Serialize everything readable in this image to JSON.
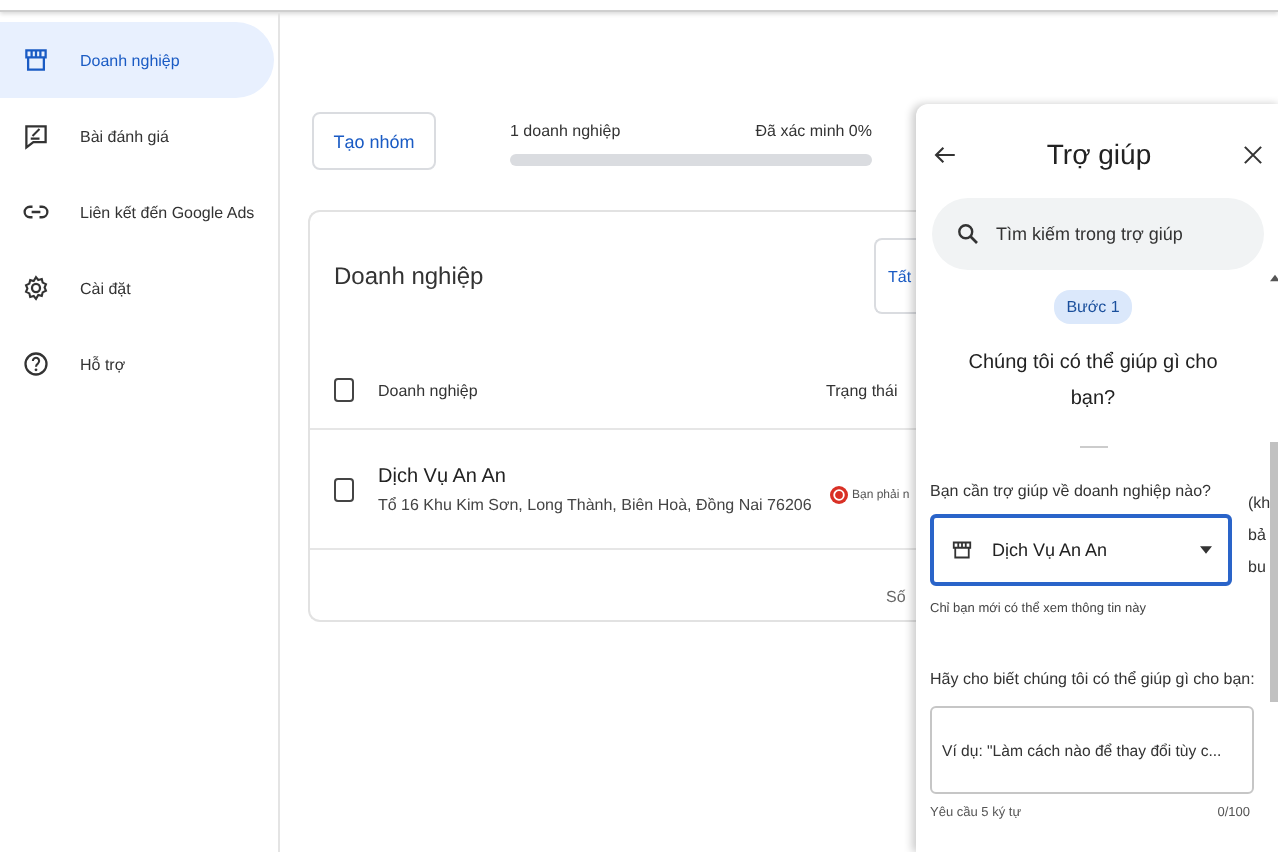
{
  "sidebar": {
    "items": [
      {
        "label": "Doanh nghiệp",
        "kind": "store",
        "selected": true
      },
      {
        "label": "Bài đánh giá",
        "kind": "review",
        "selected": false
      },
      {
        "label": "Liên kết đến Google Ads",
        "kind": "link",
        "selected": false
      },
      {
        "label": "Cài đặt",
        "kind": "settings",
        "selected": false
      },
      {
        "label": "Hỗ trợ",
        "kind": "help",
        "selected": false
      }
    ]
  },
  "toolbar": {
    "create_group_button": "Tạo nhóm",
    "business_count": "1 doanh nghiệp",
    "verified": "Đã xác minh 0%",
    "verified_progress": {
      "level": 0
    }
  },
  "card": {
    "title": "Doanh nghiệp",
    "filter_button": "Tất",
    "header_checked": false,
    "columns": [
      "Doanh nghiệp",
      "Trạng thái"
    ],
    "rows": [
      {
        "name": "Dịch Vụ An An",
        "address": "Tổ 16 Khu Kim Sơn, Long Thành, Biên Hoà, Đồng Nai 76206",
        "checked": false,
        "status": "Bạn phải n"
      }
    ],
    "footer": "Số"
  },
  "help_panel": {
    "title": "Trợ giúp",
    "search": {
      "placeholder": "Tìm kiếm trong trợ giúp"
    },
    "step": "Bước 1",
    "heading": "Chúng tôi có thể giúp gì cho bạn?",
    "business_label": "Bạn cần trợ giúp về doanh nghiệp nào?",
    "business_select": {
      "value": "Dịch Vụ An An"
    },
    "side_text": [
      "(kh",
      "bả",
      "bu"
    ],
    "business_hint": "Chỉ bạn mới có thể xem thông tin này",
    "question_label": "Hãy cho biết chúng tôi có thể giúp gì cho bạn:",
    "question_field": {
      "placeholder": "Ví dụ: \"Làm cách nào để thay đổi tùy c..."
    },
    "requirement": "Yêu cầu 5 ký tự",
    "counter": "0/100"
  }
}
